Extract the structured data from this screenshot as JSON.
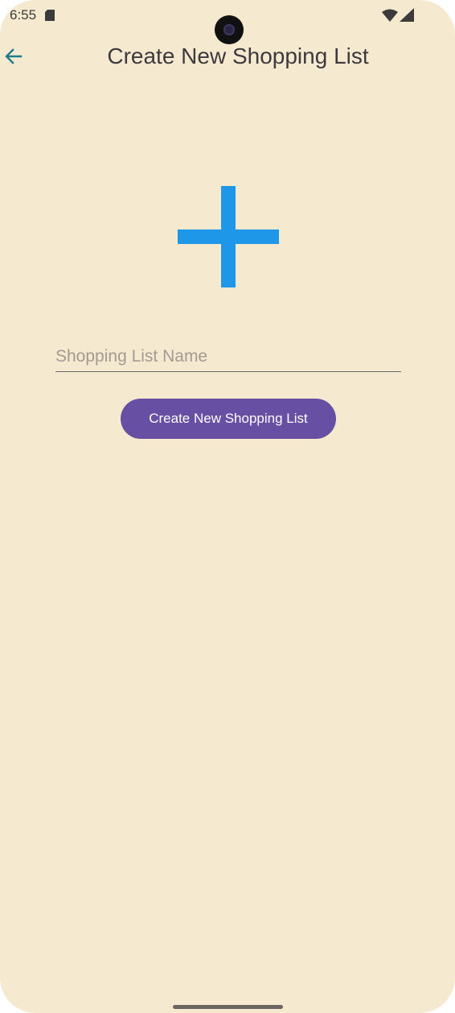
{
  "status_bar": {
    "time": "6:55",
    "icons": [
      "sd-card-icon",
      "wifi-icon",
      "signal-icon"
    ]
  },
  "app_bar": {
    "back_icon": "arrow-back-icon",
    "title": "Create New Shopping List"
  },
  "main": {
    "graphic_icon": "plus-icon",
    "name_input": {
      "placeholder": "Shopping List Name",
      "value": ""
    },
    "create_button_label": "Create New Shopping List"
  },
  "colors": {
    "background": "#f5e9cf",
    "accent_blue": "#1e97e9",
    "button_purple": "#6750a4",
    "back_arrow_teal": "#1f7c8a"
  }
}
